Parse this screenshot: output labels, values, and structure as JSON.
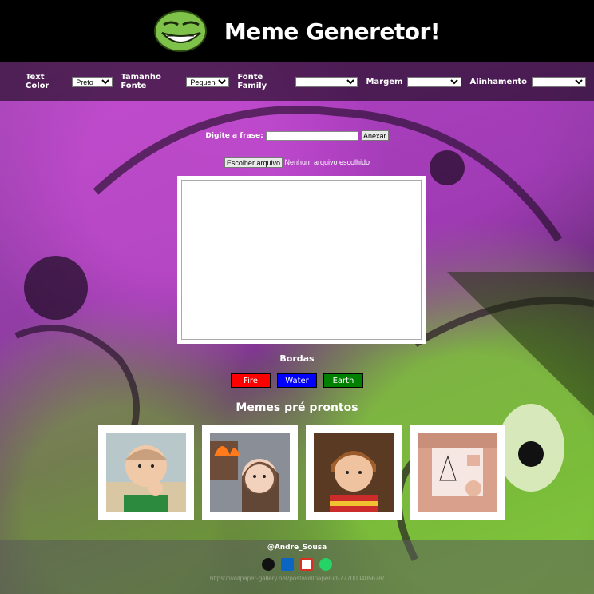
{
  "header": {
    "title": "Meme Generetor!",
    "logo_icon": "troll-face-icon"
  },
  "toolbar": {
    "text_color": {
      "label": "Text Color",
      "selected": "Preto"
    },
    "font_size": {
      "label": "Tamanho Fonte",
      "selected": "Pequena"
    },
    "font_family": {
      "label": "Fonte Family",
      "selected": ""
    },
    "margin": {
      "label": "Margem",
      "selected": ""
    },
    "alignment": {
      "label": "Alinhamento",
      "selected": ""
    }
  },
  "phrase": {
    "label": "Digite a frase:",
    "value": "",
    "button": "Anexar"
  },
  "file": {
    "button": "Escolher arquivo",
    "status": "Nenhum arquivo escolhido"
  },
  "borders": {
    "title": "Bordas",
    "buttons": [
      {
        "label": "Fire",
        "color": "#ff0000"
      },
      {
        "label": "Water",
        "color": "#0000ff"
      },
      {
        "label": "Earth",
        "color": "#008000"
      }
    ]
  },
  "memes": {
    "title": "Memes pré prontos",
    "items": [
      "success-kid",
      "disaster-girl",
      "angry-boy",
      "math-lady"
    ]
  },
  "footer": {
    "handle": "@Andre_Sousa",
    "icons": [
      "github-icon",
      "linkedin-icon",
      "gmail-icon",
      "whatsapp-icon"
    ],
    "credit": "https://wallpaper-gallery.net/post/wallpaper-id-777000405678/"
  }
}
